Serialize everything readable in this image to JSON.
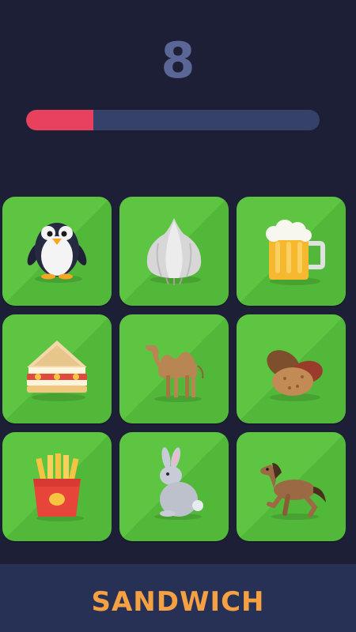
{
  "game": {
    "score": "8",
    "time_remaining": 0.23,
    "target_word": "SANDWICH",
    "colors": {
      "background": "#1c1f35",
      "score_text": "#5a6695",
      "timer_fill": "#e8415d",
      "timer_track": "#36416a",
      "tile": "#5ec543",
      "footer": "#273055",
      "word": "#f5a043"
    }
  },
  "tiles": [
    {
      "icon": "penguin-icon"
    },
    {
      "icon": "garlic-icon"
    },
    {
      "icon": "beer-mug-icon"
    },
    {
      "icon": "sandwich-icon"
    },
    {
      "icon": "camel-icon"
    },
    {
      "icon": "potatoes-icon"
    },
    {
      "icon": "french-fries-icon"
    },
    {
      "icon": "rabbit-icon"
    },
    {
      "icon": "horse-icon"
    }
  ]
}
